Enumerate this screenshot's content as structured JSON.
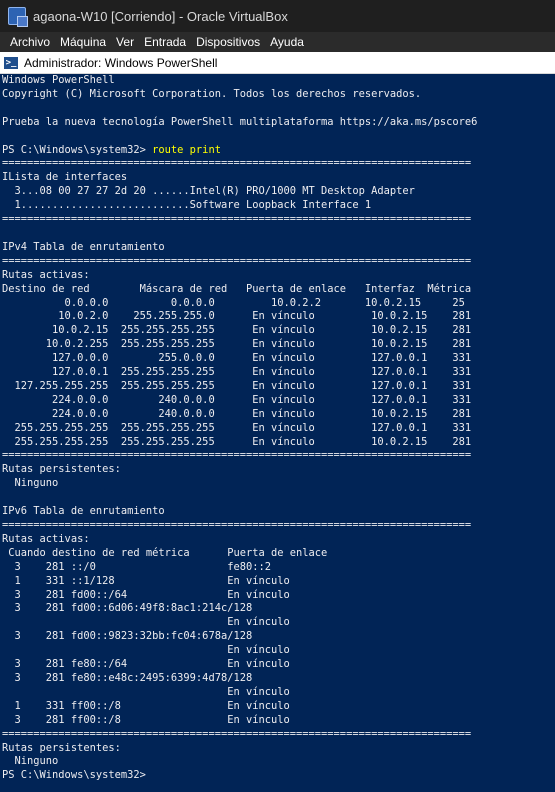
{
  "vbox": {
    "window_title": "agaona-W10 [Corriendo] - Oracle VirtualBox",
    "menu": [
      "Archivo",
      "Máquina",
      "Ver",
      "Entrada",
      "Dispositivos",
      "Ayuda"
    ]
  },
  "powershell": {
    "window_title": "Administrador: Windows PowerShell",
    "prompt": "PS C:\\Windows\\system32> ",
    "command": "route print",
    "output_lines": [
      "Windows PowerShell",
      "Copyright (C) Microsoft Corporation. Todos los derechos reservados.",
      "",
      "Prueba la nueva tecnología PowerShell multiplataforma https://aka.ms/pscore6",
      ""
    ],
    "route_output_lines": [
      "===========================================================================",
      "ILista de interfaces",
      "  3...08 00 27 27 2d 20 ......Intel(R) PRO/1000 MT Desktop Adapter",
      "  1...........................Software Loopback Interface 1",
      "===========================================================================",
      "",
      "IPv4 Tabla de enrutamiento",
      "===========================================================================",
      "Rutas activas:",
      "Destino de red        Máscara de red   Puerta de enlace   Interfaz  Métrica",
      "          0.0.0.0          0.0.0.0         10.0.2.2       10.0.2.15     25",
      "         10.0.2.0    255.255.255.0      En vínculo         10.0.2.15    281",
      "        10.0.2.15  255.255.255.255      En vínculo         10.0.2.15    281",
      "       10.0.2.255  255.255.255.255      En vínculo         10.0.2.15    281",
      "        127.0.0.0        255.0.0.0      En vínculo         127.0.0.1    331",
      "        127.0.0.1  255.255.255.255      En vínculo         127.0.0.1    331",
      "  127.255.255.255  255.255.255.255      En vínculo         127.0.0.1    331",
      "        224.0.0.0        240.0.0.0      En vínculo         127.0.0.1    331",
      "        224.0.0.0        240.0.0.0      En vínculo         10.0.2.15    281",
      "  255.255.255.255  255.255.255.255      En vínculo         127.0.0.1    331",
      "  255.255.255.255  255.255.255.255      En vínculo         10.0.2.15    281",
      "===========================================================================",
      "Rutas persistentes:",
      "  Ninguno",
      "",
      "IPv6 Tabla de enrutamiento",
      "===========================================================================",
      "Rutas activas:",
      " Cuando destino de red métrica      Puerta de enlace",
      "  3    281 ::/0                     fe80::2",
      "  1    331 ::1/128                  En vínculo",
      "  3    281 fd00::/64                En vínculo",
      "  3    281 fd00::6d06:49f8:8ac1:214c/128",
      "                                    En vínculo",
      "  3    281 fd00::9823:32bb:fc04:678a/128",
      "                                    En vínculo",
      "  3    281 fe80::/64                En vínculo",
      "  3    281 fe80::e48c:2495:6399:4d78/128",
      "                                    En vínculo",
      "  1    331 ff00::/8                 En vínculo",
      "  3    281 ff00::/8                 En vínculo",
      "===========================================================================",
      "Rutas persistentes:",
      "  Ninguno"
    ],
    "final_prompt": "PS C:\\Windows\\system32>"
  }
}
